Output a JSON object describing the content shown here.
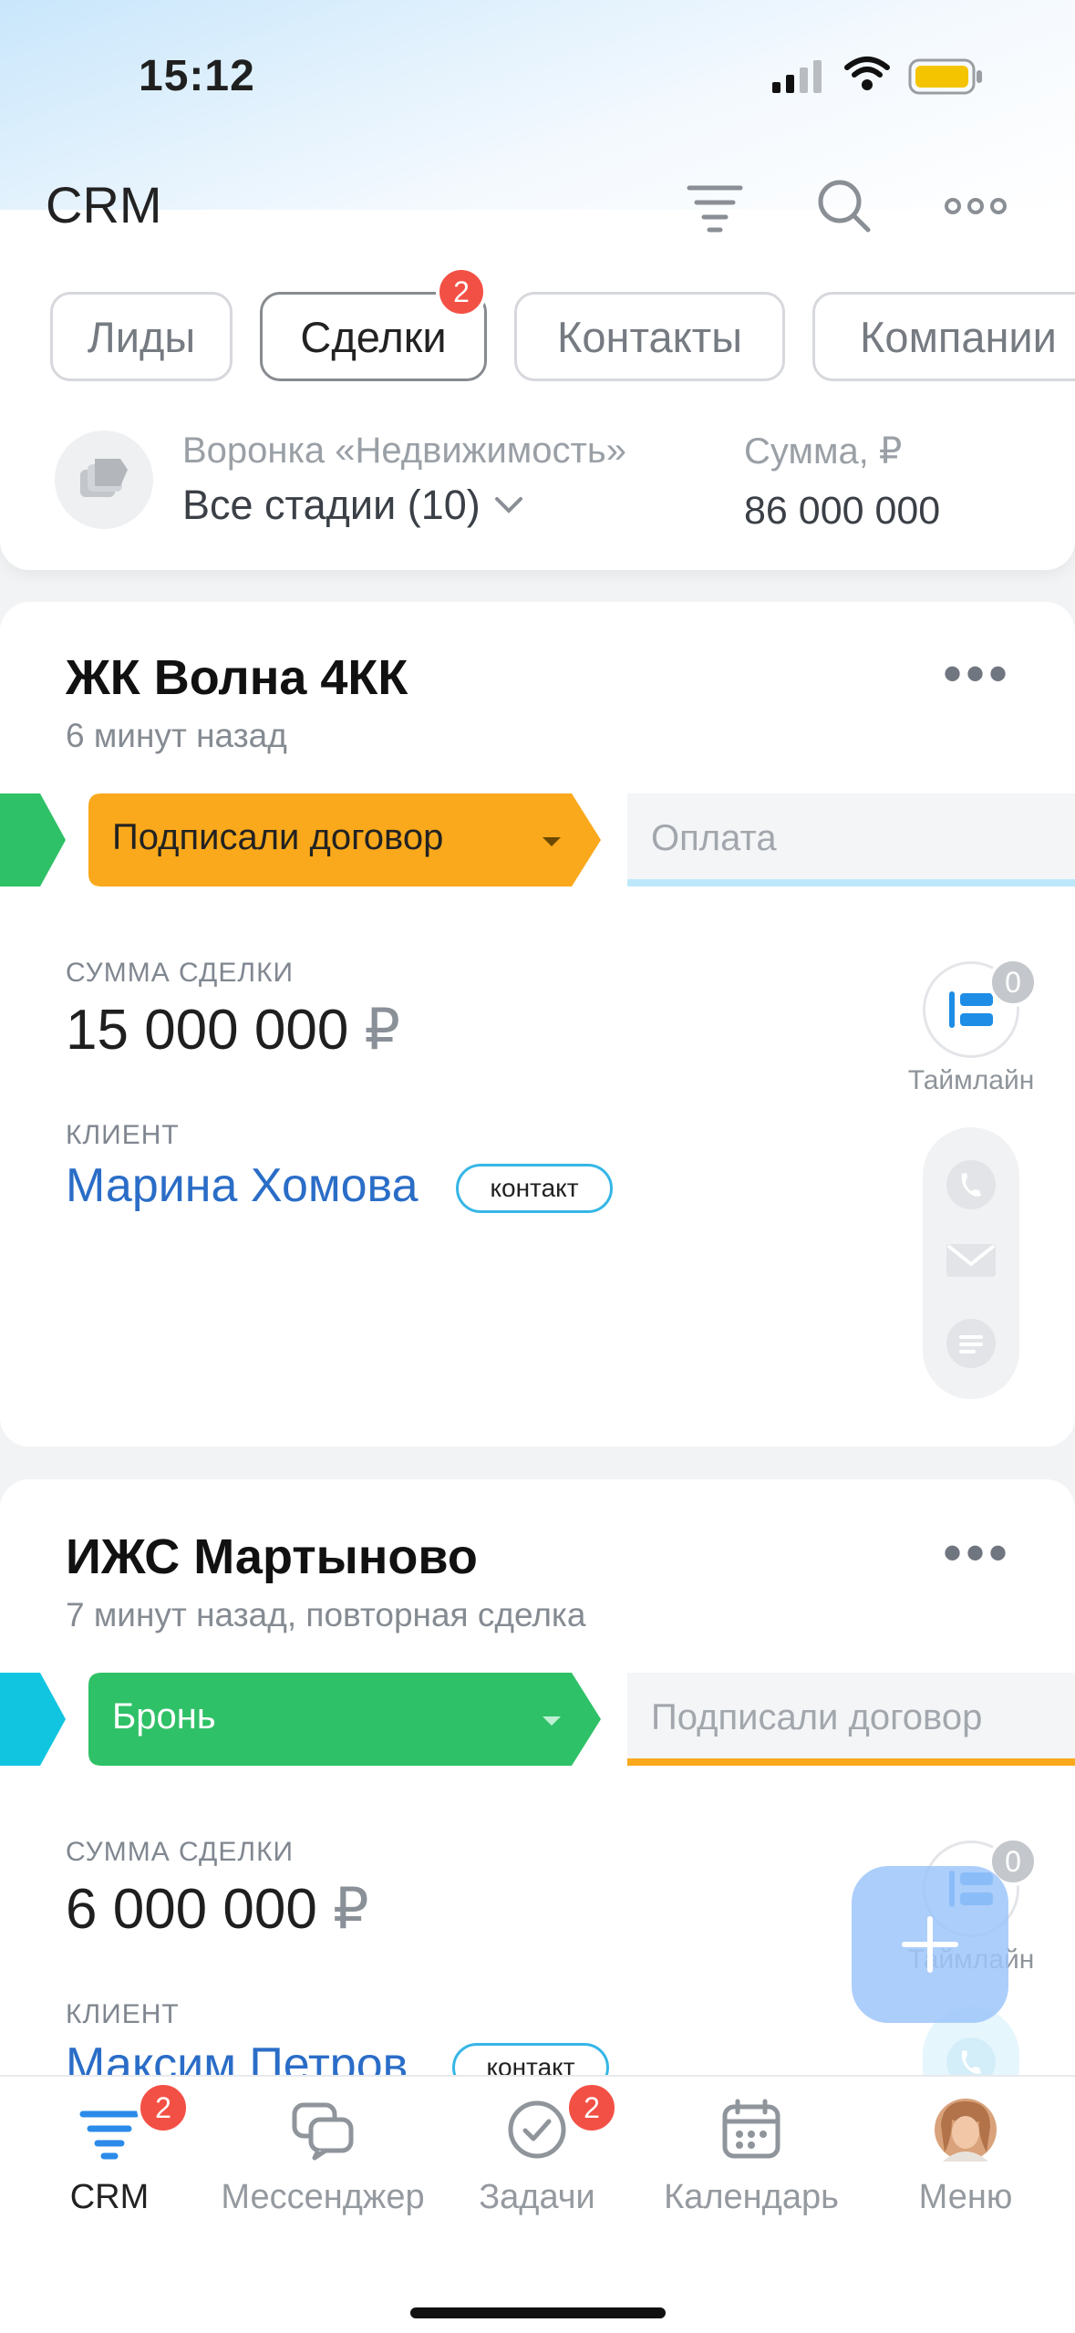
{
  "status_bar": {
    "time": "15:12"
  },
  "header": {
    "title": "CRM"
  },
  "tabs": [
    {
      "label": "Лиды"
    },
    {
      "label": "Сделки",
      "badge": "2"
    },
    {
      "label": "Контакты"
    },
    {
      "label": "Компании"
    }
  ],
  "funnel": {
    "name": "Воронка «Недвижимость»",
    "stages": "Все стадии (10)",
    "sum_label": "Сумма, ₽",
    "sum_value": "86 000 000"
  },
  "deals": [
    {
      "title": "ЖК Волна 4КК",
      "subtitle": "6 минут назад",
      "stage": "Подписали договор",
      "next_stage": "Оплата",
      "amount_label": "СУММА СДЕЛКИ",
      "amount": "15 000 000",
      "currency": "₽",
      "client_label": "КЛИЕНТ",
      "client_name": "Марина Хомова",
      "client_type": "контакт",
      "timeline_label": "Таймлайн",
      "timeline_count": "0"
    },
    {
      "title": "ИЖС Мартыново",
      "subtitle": "7 минут назад, повторная сделка",
      "stage": "Бронь",
      "next_stage": "Подписали договор",
      "amount_label": "СУММА СДЕЛКИ",
      "amount": "6 000 000",
      "currency": "₽",
      "client_label": "КЛИЕНТ",
      "client_name": "Максим Петров",
      "client_type": "контакт",
      "timeline_label": "Таймлайн",
      "timeline_count": "0"
    }
  ],
  "bottom_nav": [
    {
      "label": "CRM",
      "badge": "2"
    },
    {
      "label": "Мессенджер"
    },
    {
      "label": "Задачи",
      "badge": "2"
    },
    {
      "label": "Календарь"
    },
    {
      "label": "Меню"
    }
  ],
  "colors": {
    "accent_blue": "#2fc6f6",
    "stage_orange": "#f9a91b",
    "stage_green": "#2fc167",
    "badge_red": "#f35045",
    "link_blue": "#2a6dc7"
  },
  "icons": [
    "filter-icon",
    "search-icon",
    "more-icon",
    "funnel-icon",
    "chevron-down-icon",
    "timeline-icon",
    "phone-icon",
    "mail-icon",
    "chat-icon",
    "plus-icon",
    "messenger-icon",
    "tasks-icon",
    "calendar-icon",
    "avatar"
  ]
}
